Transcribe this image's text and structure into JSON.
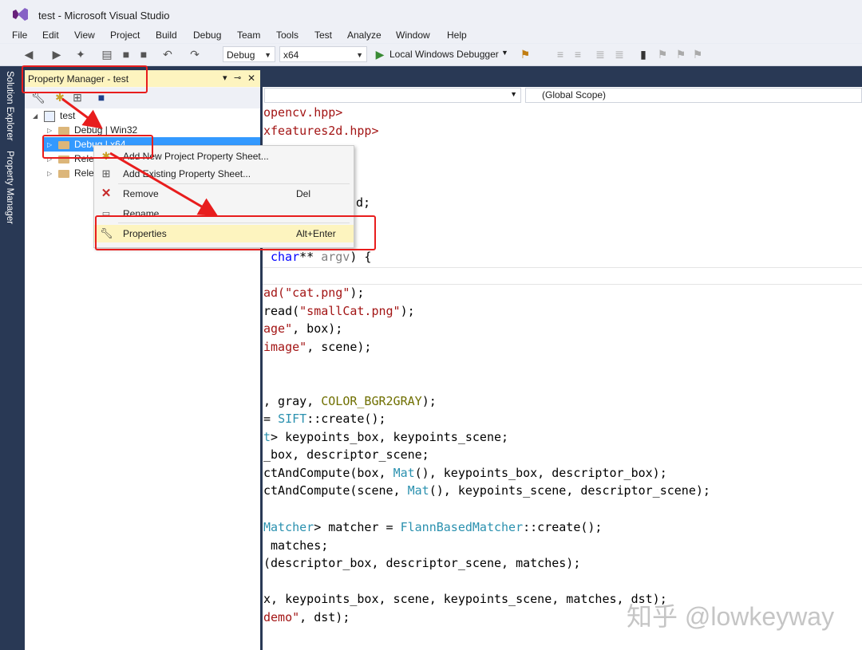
{
  "window": {
    "title": "test - Microsoft Visual Studio"
  },
  "menu": [
    "File",
    "Edit",
    "View",
    "Project",
    "Build",
    "Debug",
    "Team",
    "Tools",
    "Test",
    "Analyze",
    "Window",
    "Help"
  ],
  "toolbar": {
    "config": "Debug",
    "platform": "x64",
    "debugger": "Local Windows Debugger"
  },
  "side_tabs": [
    "Solution Explorer",
    "Property Manager"
  ],
  "property_manager": {
    "title": "Property Manager - test",
    "title_controls": {
      "dropdown": "▾",
      "pin": "⊸",
      "close": "✕"
    },
    "tree": {
      "root": "test",
      "items": [
        "Debug | Win32",
        "Debug | x64",
        "Rele",
        "Rele"
      ]
    }
  },
  "context_menu": {
    "items": [
      {
        "label": "Add New Project Property Sheet...",
        "shortcut": "",
        "icon": "new-sheet-icon"
      },
      {
        "label": "Add Existing Property Sheet...",
        "shortcut": "",
        "icon": "existing-sheet-icon"
      },
      {
        "label": "Remove",
        "shortcut": "Del",
        "icon": "remove-icon"
      },
      {
        "label": "Rename",
        "shortcut": "",
        "icon": "rename-icon"
      },
      {
        "label": "Properties",
        "shortcut": "Alt+Enter",
        "icon": "wrench-icon"
      }
    ]
  },
  "editor": {
    "scope": "(Global Scope)",
    "lines": [
      "opencv.hpp>",
      "xfeatures2d.hpp>",
      "d;",
      "char** argv) {",
      "ad(\"cat.png\");",
      "read(\"smallCat.png\");",
      "age\", box);",
      "image\", scene);",
      ", gray, COLOR_BGR2GRAY);",
      "= SIFT::create();",
      "t> keypoints_box, keypoints_scene;",
      "_box, descriptor_scene;",
      "ctAndCompute(box, Mat(), keypoints_box, descriptor_box);",
      "ctAndCompute(scene, Mat(), keypoints_scene, descriptor_scene);",
      "Matcher> matcher = FlannBasedMatcher::create();",
      " matches;",
      "(descriptor_box, descriptor_scene, matches);",
      "x, keypoints_box, scene, keypoints_scene, matches, dst);",
      "demo\", dst);"
    ]
  },
  "watermark": "知乎 @lowkeyway",
  "colors": {
    "annotation_red": "#e81d1d",
    "selection_blue": "#3399ff",
    "panel_title_yellow": "#fdf4bf",
    "frame_navy": "#293955"
  }
}
